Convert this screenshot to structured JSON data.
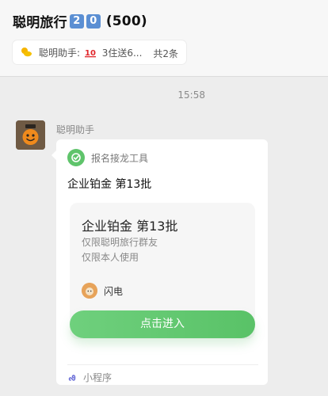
{
  "header": {
    "title": "聪明旅行",
    "badge_digits": [
      "2",
      "0"
    ],
    "member_count": "(500)"
  },
  "pinned": {
    "sender": "聪明助手:",
    "emoji": "💯",
    "text": "3住送6...",
    "count": "共2条"
  },
  "chat": {
    "timestamp": "15:58",
    "sender_name": "聪明助手",
    "card": {
      "app_name": "报名接龙工具",
      "title": "企业铂金 第13批",
      "preview_title": "企业铂金 第13批",
      "preview_line1": "仅限聪明旅行群友",
      "preview_line2": "仅限本人使用",
      "creator": "闪电",
      "enter_label": "点击进入",
      "footer_label": "小程序"
    }
  },
  "colors": {
    "accent_green": "#5fc46b",
    "badge_blue": "#5b8fd3"
  }
}
